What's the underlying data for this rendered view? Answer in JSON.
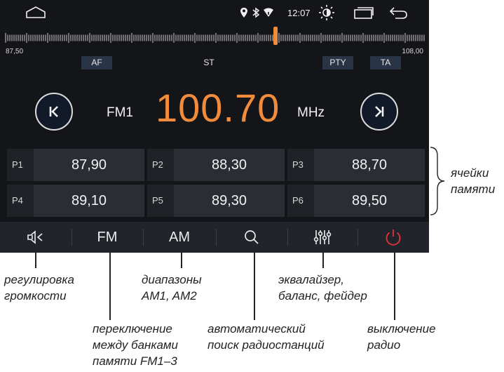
{
  "status": {
    "time": "12:07",
    "icons": [
      "home-icon",
      "location-icon",
      "bluetooth-icon",
      "wifi-icon",
      "brightness-icon",
      "recent-apps-icon",
      "back-icon"
    ]
  },
  "tuner": {
    "range_min": "87,50",
    "range_max": "108,00",
    "flags": {
      "af": "AF",
      "st": "ST",
      "pty": "PTY",
      "ta": "TA"
    },
    "band": "FM1",
    "frequency": "100.70",
    "unit": "MHz"
  },
  "presets": [
    {
      "label": "P1",
      "freq": "87,90"
    },
    {
      "label": "P2",
      "freq": "88,30"
    },
    {
      "label": "P3",
      "freq": "88,70"
    },
    {
      "label": "P4",
      "freq": "89,10"
    },
    {
      "label": "P5",
      "freq": "89,30"
    },
    {
      "label": "P6",
      "freq": "89,50"
    }
  ],
  "toolbar": {
    "fm": "FM",
    "am": "AM",
    "icons": [
      "volume-icon",
      "search-icon",
      "equalizer-icon",
      "power-icon"
    ]
  },
  "colors": {
    "frequency": "#f08c3c",
    "power": "#e8323c",
    "needle": "#f08c3c"
  },
  "annotations": {
    "presets_l1": "ячейки",
    "presets_l2": "памяти",
    "volume_l1": "регулировка",
    "volume_l2": "громкости",
    "fm_l1": "переключение",
    "fm_l2": "между банками",
    "fm_l3": "памяти FM1–3",
    "am_l1": "диапазоны",
    "am_l2": "AM1, AM2",
    "search_l1": "автоматический",
    "search_l2": "поиск радиостанций",
    "eq_l1": "эквалайзер,",
    "eq_l2": "баланс, фейдер",
    "power_l1": "выключение",
    "power_l2": "радио"
  }
}
